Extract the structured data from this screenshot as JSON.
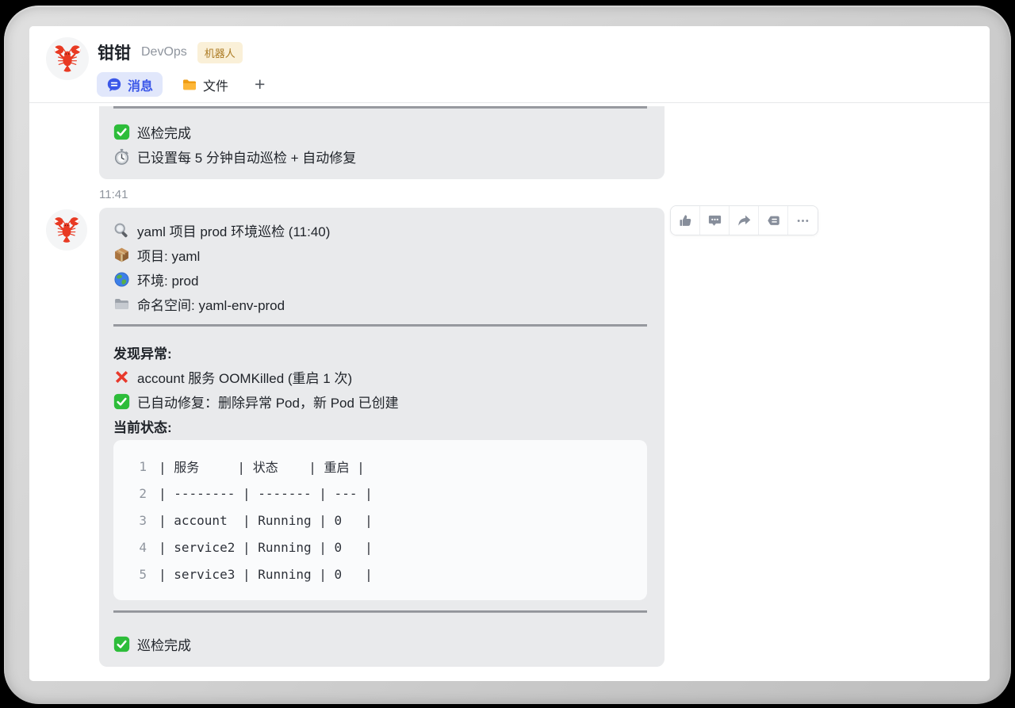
{
  "header": {
    "title": "钳钳",
    "subtitle": "DevOps",
    "badge": "机器人",
    "avatar_icon": "lobster-emoji",
    "tabs": [
      {
        "label": "消息",
        "icon": "chat-bubble-icon",
        "active": true
      },
      {
        "label": "文件",
        "icon": "folder-icon",
        "active": false
      }
    ],
    "add_tab": "+"
  },
  "chat": {
    "timestamp": "11:41",
    "messages": [
      {
        "type": "bot-bubble-partial",
        "lines": [
          {
            "icon": "check-mark-emoji",
            "text": "巡检完成"
          },
          {
            "icon": "stopwatch-emoji",
            "text": "已设置每 5 分钟自动巡检 + 自动修复"
          }
        ]
      },
      {
        "type": "bot-bubble",
        "header_lines": [
          {
            "icon": "magnifier-emoji",
            "text": "yaml 项目 prod 环境巡检 (11:40)"
          },
          {
            "icon": "package-emoji",
            "text": "项目: yaml"
          },
          {
            "icon": "globe-emoji",
            "text": "环境: prod"
          },
          {
            "icon": "gray-folder-emoji",
            "text": "命名空间: yaml-env-prod"
          }
        ],
        "alert_title": "发现异常:",
        "alert_lines": [
          {
            "icon": "cross-mark-emoji",
            "text": "account 服务 OOMKilled (重启 1 次)"
          },
          {
            "icon": "check-mark-emoji",
            "text": "已自动修复：删除异常 Pod，新 Pod 已创建"
          }
        ],
        "status_title": "当前状态:",
        "code_block": {
          "lines": [
            {
              "no": "1",
              "code": "| 服务     | 状态    | 重启 |"
            },
            {
              "no": "2",
              "code": "| -------- | ------- | --- |"
            },
            {
              "no": "3",
              "code": "| account  | Running | 0   |"
            },
            {
              "no": "4",
              "code": "| service2 | Running | 0   |"
            },
            {
              "no": "5",
              "code": "| service3 | Running | 0   |"
            }
          ]
        },
        "footer_line": {
          "icon": "check-mark-emoji",
          "text": "巡检完成"
        }
      }
    ],
    "toolbar_buttons": [
      "thumbs-up",
      "comment",
      "forward",
      "quote-reply",
      "more"
    ]
  },
  "colors": {
    "accent_blue": "#3b57e8",
    "tab_active_bg": "#e1e7fb",
    "bubble_gray": "#e9eaec",
    "badge_bg": "#faf0d8",
    "badge_text": "#ab7a22",
    "check_green": "#2dbd3a",
    "cross_red": "#e8392b",
    "toolbar_icon_gray": "#878e9b"
  }
}
